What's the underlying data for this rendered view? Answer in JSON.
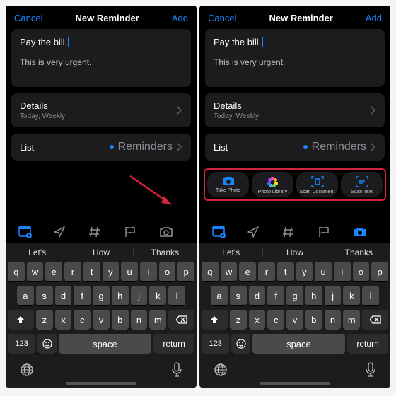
{
  "nav": {
    "cancel": "Cancel",
    "title": "New Reminder",
    "add": "Add"
  },
  "reminder": {
    "title": "Pay the bill.",
    "notes": "This is very urgent."
  },
  "details": {
    "label": "Details",
    "sub": "Today, Weekly"
  },
  "list": {
    "label": "List",
    "value": "Reminders"
  },
  "attach": {
    "takePhoto": "Take Photo",
    "photoLibrary": "Photo Library",
    "scanDocument": "Scan Document",
    "scanText": "Scan Text"
  },
  "suggestions": {
    "a": "Let's",
    "b": "How",
    "c": "Thanks"
  },
  "keyboard": {
    "r1": [
      "q",
      "w",
      "e",
      "r",
      "t",
      "y",
      "u",
      "i",
      "o",
      "p"
    ],
    "r2": [
      "a",
      "s",
      "d",
      "f",
      "g",
      "h",
      "j",
      "k",
      "l"
    ],
    "r3": [
      "z",
      "x",
      "c",
      "v",
      "b",
      "n",
      "m"
    ],
    "numKey": "123",
    "space": "space",
    "return": "return"
  }
}
